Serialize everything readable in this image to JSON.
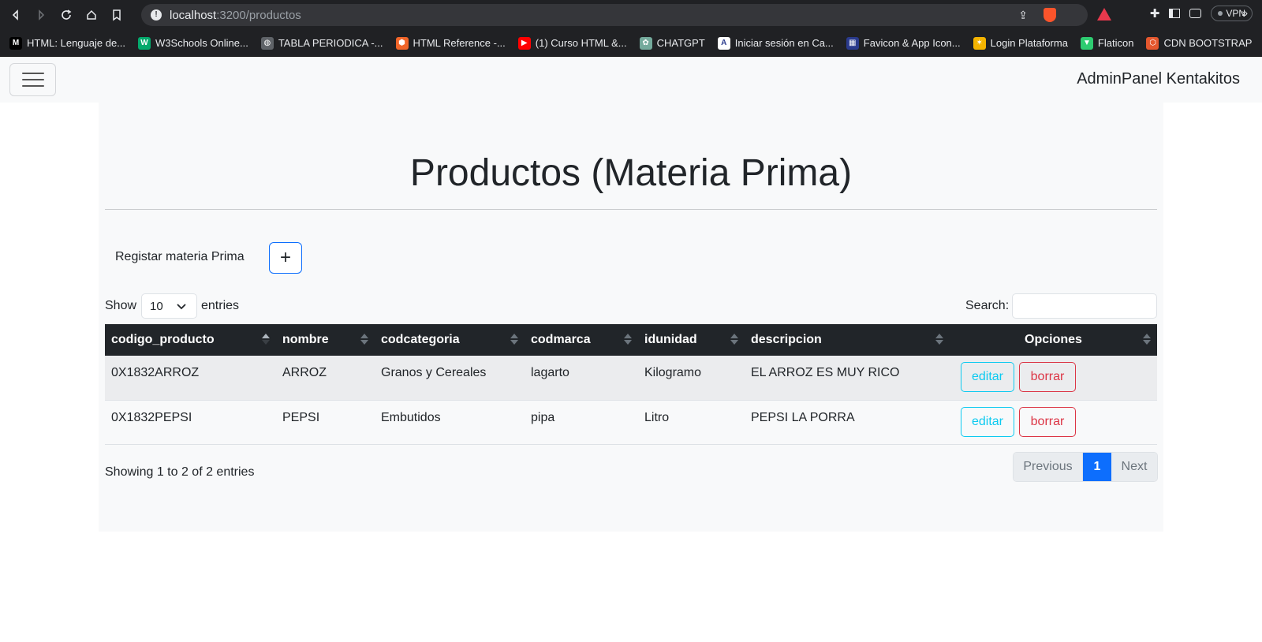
{
  "browser": {
    "url_host": "localhost",
    "url_path": ":3200/productos",
    "vpn_label": "VPN",
    "bookmarks": [
      {
        "label": "HTML: Lenguaje de...",
        "icon": "mdn-icon",
        "color": "#000000",
        "glyph": "M"
      },
      {
        "label": "W3Schools Online...",
        "icon": "w3schools-icon",
        "color": "#04aa6d",
        "glyph": "W"
      },
      {
        "label": "TABLA PERIODICA -...",
        "icon": "globe-icon",
        "color": "#5f6368",
        "glyph": "◍"
      },
      {
        "label": "HTML Reference -...",
        "icon": "html-reference-icon",
        "color": "#f06529",
        "glyph": "⬢"
      },
      {
        "label": "(1) Curso HTML &...",
        "icon": "youtube-icon",
        "color": "#ff0000",
        "glyph": "▶"
      },
      {
        "label": "CHATGPT",
        "icon": "chatgpt-icon",
        "color": "#74aa9c",
        "glyph": "✿"
      },
      {
        "label": "Iniciar sesión en Ca...",
        "icon": "canvas-icon",
        "color": "#ffffff",
        "glyph": "A"
      },
      {
        "label": "Favicon & App Icon...",
        "icon": "favicon-generator-icon",
        "color": "#2a3a8c",
        "glyph": "▦"
      },
      {
        "label": "Login Plataforma",
        "icon": "plataforma-icon",
        "color": "#f4b400",
        "glyph": "✶"
      },
      {
        "label": "Flaticon",
        "icon": "flaticon-icon",
        "color": "#2ecc71",
        "glyph": "▼"
      },
      {
        "label": "CDN BOOTSTRAP",
        "icon": "bootstrap-cdn-icon",
        "color": "#e4572e",
        "glyph": "⬡"
      }
    ],
    "more_label": "»"
  },
  "navbar": {
    "brand": "AdminPanel Kentakitos"
  },
  "page": {
    "title": "Productos (Materia Prima)",
    "register_label": "Registar materia Prima",
    "add_button_label": "+",
    "show_label": "Show",
    "entries_value": "10",
    "entries_label": "entries",
    "search_label": "Search:",
    "search_value": ""
  },
  "table": {
    "columns": [
      "codigo_producto",
      "nombre",
      "codcategoria",
      "codmarca",
      "idunidad",
      "descripcion",
      "Opciones"
    ],
    "rows": [
      {
        "codigo_producto": "0X1832ARROZ",
        "nombre": "ARROZ",
        "codcategoria": "Granos y Cereales",
        "codmarca": "lagarto",
        "idunidad": "Kilogramo",
        "descripcion": "EL ARROZ ES MUY RICO",
        "edit_label": "editar",
        "delete_label": "borrar"
      },
      {
        "codigo_producto": "0X1832PEPSI",
        "nombre": "PEPSI",
        "codcategoria": "Embutidos",
        "codmarca": "pipa",
        "idunidad": "Litro",
        "descripcion": "PEPSI LA PORRA",
        "edit_label": "editar",
        "delete_label": "borrar"
      }
    ]
  },
  "footer": {
    "info": "Showing 1 to 2 of 2 entries",
    "previous": "Previous",
    "current_page": "1",
    "next": "Next"
  },
  "colors": {
    "primary": "#0d6efd",
    "info": "#0dcaf0",
    "danger": "#dc3545",
    "dark": "#212529"
  }
}
